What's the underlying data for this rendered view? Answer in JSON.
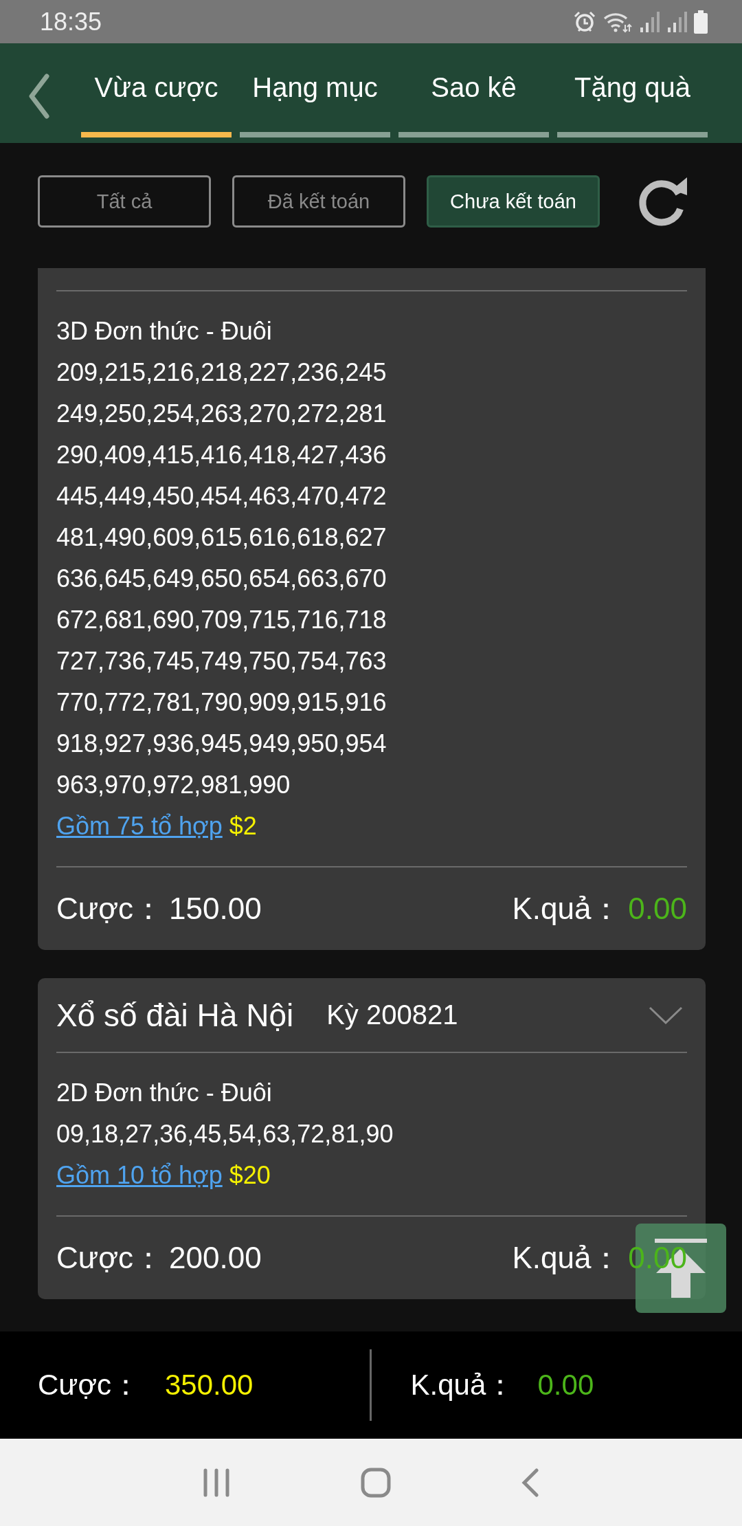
{
  "status_bar": {
    "time": "18:35"
  },
  "tabs": [
    {
      "label": "Vừa cược",
      "selected": true
    },
    {
      "label": "Hạng mục",
      "selected": false
    },
    {
      "label": "Sao kê",
      "selected": false
    },
    {
      "label": "Tặng quà",
      "selected": false
    }
  ],
  "filters": [
    {
      "label": "Tất cả",
      "selected": false
    },
    {
      "label": "Đã kết toán",
      "selected": false
    },
    {
      "label": "Chưa kết toán",
      "selected": true
    }
  ],
  "bets": [
    {
      "bet_type": "3D Đơn thức - Đuôi",
      "numbers": [
        "209,215,216,218,227,236,245",
        "249,250,254,263,270,272,281",
        "290,409,415,416,418,427,436",
        "445,449,450,454,463,470,472",
        "481,490,609,615,616,618,627",
        "636,645,649,650,654,663,670",
        "672,681,690,709,715,716,718",
        "727,736,745,749,750,754,763",
        "770,772,781,790,909,915,916",
        "918,927,936,945,949,950,954",
        "963,970,972,981,990"
      ],
      "combos_link": "Gồm 75 tổ hợp",
      "unit_price": "$2",
      "stake_label": "Cược：",
      "stake": "150.00",
      "result_label": "K.quả：",
      "result": "0.00"
    },
    {
      "lottery": "Xổ số đài Hà Nội",
      "period": "Kỳ 200821",
      "bet_type": "2D Đơn thức - Đuôi",
      "numbers": [
        "09,18,27,36,45,54,63,72,81,90"
      ],
      "combos_link": "Gồm 10 tổ hợp",
      "unit_price": "$20",
      "stake_label": "Cược：",
      "stake": "200.00",
      "result_label": "K.quả：",
      "result": "0.00"
    }
  ],
  "summary": {
    "stake_label": "Cược：",
    "stake": "350.00",
    "result_label": "K.quả：",
    "result": "0.00"
  }
}
